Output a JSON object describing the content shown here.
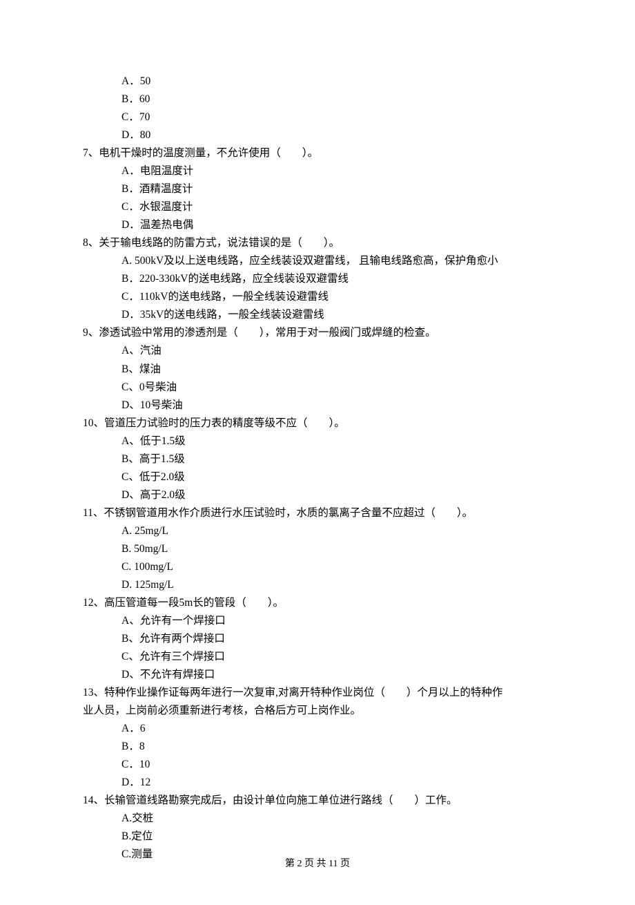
{
  "items": [
    {
      "cls": "option-row",
      "text": "A．50"
    },
    {
      "cls": "option-row",
      "text": "B．60"
    },
    {
      "cls": "option-row",
      "text": "C．70"
    },
    {
      "cls": "option-row",
      "text": "D．80"
    },
    {
      "cls": "question-row",
      "text": "7、电机干燥时的温度测量，不允许使用（　　）。"
    },
    {
      "cls": "option-row",
      "text": "A．电阻温度计"
    },
    {
      "cls": "option-row",
      "text": "B．酒精温度计"
    },
    {
      "cls": "option-row",
      "text": "C．水银温度计"
    },
    {
      "cls": "option-row",
      "text": "D．温差热电偶"
    },
    {
      "cls": "question-row",
      "text": "8、关于输电线路的防雷方式，说法错误的是（　　）。"
    },
    {
      "cls": "option-row",
      "text": "A. 500kV及以上送电线路，应全线装设双避雷线， 且输电线路愈高，保护角愈小"
    },
    {
      "cls": "option-row",
      "text": "B．220-330kV的送电线路，应全线装设双避雷线"
    },
    {
      "cls": "option-row",
      "text": "C．110kV的送电线路，一般全线装设避雷线"
    },
    {
      "cls": "option-row",
      "text": "D．35kV的送电线路，一般全线装设避雷线"
    },
    {
      "cls": "question-row",
      "text": "9、渗透试验中常用的渗透剂是（　　），常用于对一般阀门或焊缝的检查。"
    },
    {
      "cls": "option-row",
      "text": "A、汽油"
    },
    {
      "cls": "option-row",
      "text": "B、煤油"
    },
    {
      "cls": "option-row",
      "text": "C、0号柴油"
    },
    {
      "cls": "option-row",
      "text": "D、10号柴油"
    },
    {
      "cls": "question-row",
      "text": "10、管道压力试验时的压力表的精度等级不应（　　）。"
    },
    {
      "cls": "option-row",
      "text": "A、低于1.5级"
    },
    {
      "cls": "option-row",
      "text": "B、高于1.5级"
    },
    {
      "cls": "option-row",
      "text": "C、低于2.0级"
    },
    {
      "cls": "option-row",
      "text": "D、高于2.0级"
    },
    {
      "cls": "question-row",
      "text": "11、不锈钢管道用水作介质进行水压试验时，水质的氯离子含量不应超过（　　）。"
    },
    {
      "cls": "option-row",
      "text": "A. 25mg/L"
    },
    {
      "cls": "option-row",
      "text": "B. 50mg/L"
    },
    {
      "cls": "option-row",
      "text": "C. 100mg/L"
    },
    {
      "cls": "option-row",
      "text": "D. 125mg/L"
    },
    {
      "cls": "question-row",
      "text": "12、高压管道每一段5m长的管段（　　）。"
    },
    {
      "cls": "option-row",
      "text": "A、允许有一个焊接口"
    },
    {
      "cls": "option-row",
      "text": "B、允许有两个焊接口"
    },
    {
      "cls": "option-row",
      "text": "C、允许有三个焊接口"
    },
    {
      "cls": "option-row",
      "text": "D、不允许有焊接口"
    },
    {
      "cls": "question-row",
      "text": "13、特种作业操作证每两年进行一次复审,对离开特种作业岗位（　　）个月以上的特种作"
    },
    {
      "cls": "question-row",
      "text": "业人员，上岗前必须重新进行考核，合格后方可上岗作业。"
    },
    {
      "cls": "option-row",
      "text": "A．6"
    },
    {
      "cls": "option-row",
      "text": "B．8"
    },
    {
      "cls": "option-row",
      "text": "C．10"
    },
    {
      "cls": "option-row",
      "text": "D．12"
    },
    {
      "cls": "question-row",
      "text": "14、长输管道线路勘察完成后，由设计单位向施工单位进行路线（　　）工作。"
    },
    {
      "cls": "option-row",
      "text": "A.交桩"
    },
    {
      "cls": "option-row",
      "text": "B.定位"
    },
    {
      "cls": "option-row",
      "text": "C.测量"
    }
  ],
  "footer": "第 2 页 共 11 页"
}
